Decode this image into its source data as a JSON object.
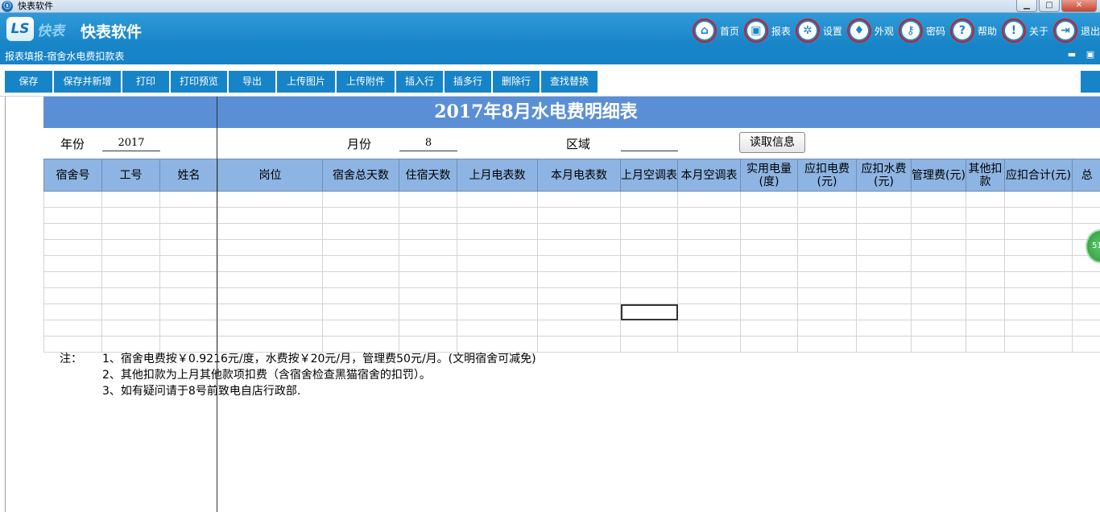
{
  "window": {
    "title": "快表软件"
  },
  "header": {
    "logo_text": "LS",
    "brand_mark": "快表",
    "app_name": "快表软件",
    "nav": [
      {
        "label": "首页",
        "icon": "home-icon",
        "glyph": "⌂"
      },
      {
        "label": "报表",
        "icon": "report-icon",
        "glyph": "▣"
      },
      {
        "label": "设置",
        "icon": "gear-icon",
        "glyph": "✲"
      },
      {
        "label": "外观",
        "icon": "shirt-icon",
        "glyph": "♦"
      },
      {
        "label": "密码",
        "icon": "key-icon",
        "glyph": "⚷"
      },
      {
        "label": "帮助",
        "icon": "help-icon",
        "glyph": "?"
      },
      {
        "label": "关于",
        "icon": "info-icon",
        "glyph": "!"
      },
      {
        "label": "退出",
        "icon": "exit-icon",
        "glyph": "⇥"
      }
    ]
  },
  "subtitle": "报表填报-宿舍水电费扣款表",
  "toolbar": [
    "保存",
    "保存并新增",
    "打印",
    "打印预览",
    "导出",
    "上传图片",
    "上传附件",
    "插入行",
    "插多行",
    "删除行",
    "查找替换"
  ],
  "sheet": {
    "title": "2017年8月水电费明细表",
    "year_label": "年份",
    "year_value": "2017",
    "month_label": "月份",
    "month_value": "8",
    "region_label": "区域",
    "region_value": "",
    "read_button": "读取信息",
    "columns": [
      "宿舍号",
      "工号",
      "姓名",
      "岗位",
      "宿舍总天数",
      "住宿天数",
      "上月电表数",
      "本月电表数",
      "上月空调表",
      "本月空调表",
      "实用电量(度)",
      "应扣电费(元)",
      "应扣水费(元)",
      "管理费(元)",
      "其他扣款",
      "应扣合计(元)",
      "总"
    ],
    "row_count": 10,
    "notes_label": "注：",
    "notes": [
      "1、宿舍电费按￥0.9216元/度，水费按￥20元/月，管理费50元/月。(文明宿舍可减免)",
      "2、其他扣款为上月其他款项扣费（含宿舍检查黑猫宿舍的扣罚）。",
      "3、如有疑问请于8号前致电自店行政部."
    ]
  },
  "float_badge": "51"
}
